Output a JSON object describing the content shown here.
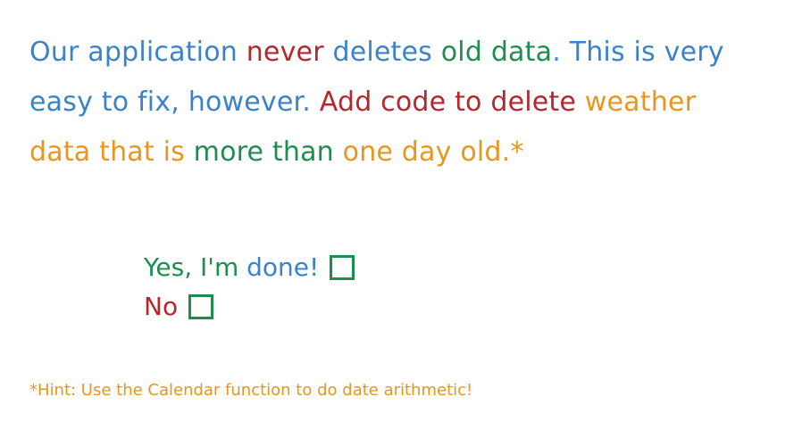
{
  "task": {
    "line1": {
      "part1": "Our application ",
      "part2": "never",
      "part3": " deletes ",
      "part4": "old data",
      "part5": ".  This is very"
    },
    "line2": {
      "part1": "easy to fix, however.  ",
      "part2": "Add code to delete ",
      "part3": "weather"
    },
    "line3": {
      "part1": "data that is ",
      "part2": "more than ",
      "part3": "one day old",
      "part4": ".*"
    }
  },
  "answers": {
    "yes_label_a": "Yes, I'm ",
    "yes_label_b": "done!",
    "no_label": "No"
  },
  "hint": "*Hint: Use the Calendar function to do date arithmetic!",
  "colors": {
    "blue": "#3b83c9",
    "red": "#b3272d",
    "green": "#1f8d4e",
    "orange": "#e8961e"
  }
}
